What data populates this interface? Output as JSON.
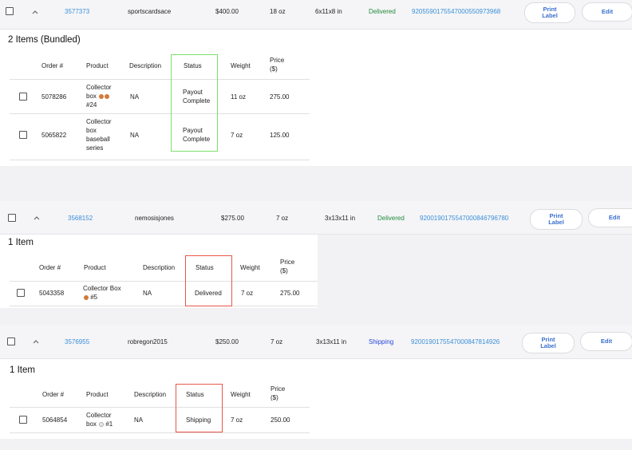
{
  "orders": [
    {
      "order_id": "3577373",
      "buyer": "sportscardsace",
      "price": "$400.00",
      "weight": "18 oz",
      "dimensions": "6x11x8 in",
      "status": "Delivered",
      "status_color": "#1f8a3a",
      "tracking": "9205590175547000550973968",
      "print_label": "Print Label",
      "edit_label": "Edit",
      "group_title": "2 Items (Bundled)",
      "columns": [
        "Order #",
        "Product",
        "Description",
        "Status",
        "Weight",
        "Price ($)"
      ],
      "items": [
        {
          "order_no": "5078286",
          "product": "Collector box #24",
          "product_icons": [
            "basketball-icon",
            "basketball-icon"
          ],
          "description": "NA",
          "status": "Payout Complete",
          "weight": "11 oz",
          "price": "275.00"
        },
        {
          "order_no": "5065822",
          "product": "Collector box baseball series",
          "product_icons": [],
          "description": "NA",
          "status": "Payout Complete",
          "weight": "7 oz",
          "price": "125.00"
        }
      ],
      "highlight_color": "#7be06a"
    },
    {
      "order_id": "3568152",
      "buyer": "nemosisjones",
      "price": "$275.00",
      "weight": "7 oz",
      "dimensions": "3x13x11 in",
      "status": "Delivered",
      "status_color": "#1f8a3a",
      "tracking": "9200190175547000846796780",
      "print_label": "Print Label",
      "edit_label": "Edit",
      "group_title": "1 Item",
      "columns": [
        "Order #",
        "Product",
        "Description",
        "Status",
        "Weight",
        "Price ($)"
      ],
      "items": [
        {
          "order_no": "5043358",
          "product": "Collector Box #5",
          "product_icons": [
            "basketball-icon"
          ],
          "description": "NA",
          "status": "Delivered",
          "weight": "7 oz",
          "price": "275.00"
        }
      ],
      "highlight_color": "#e8584a"
    },
    {
      "order_id": "3576955",
      "buyer": "robregon2015",
      "price": "$250.00",
      "weight": "7 oz",
      "dimensions": "3x13x11 in",
      "status": "Shipping",
      "status_color": "#2545d8",
      "tracking": "9200190175547000847814926",
      "print_label": "Print Label",
      "edit_label": "Edit",
      "group_title": "1 Item",
      "columns": [
        "Order #",
        "Product",
        "Description",
        "Status",
        "Weight",
        "Price ($)"
      ],
      "items": [
        {
          "order_no": "5064854",
          "product": "Collector box #1",
          "product_icons": [
            "baseball-icon"
          ],
          "description": "NA",
          "status": "Shipping",
          "weight": "7 oz",
          "price": "250.00"
        }
      ],
      "highlight_color": "#e8584a"
    }
  ]
}
